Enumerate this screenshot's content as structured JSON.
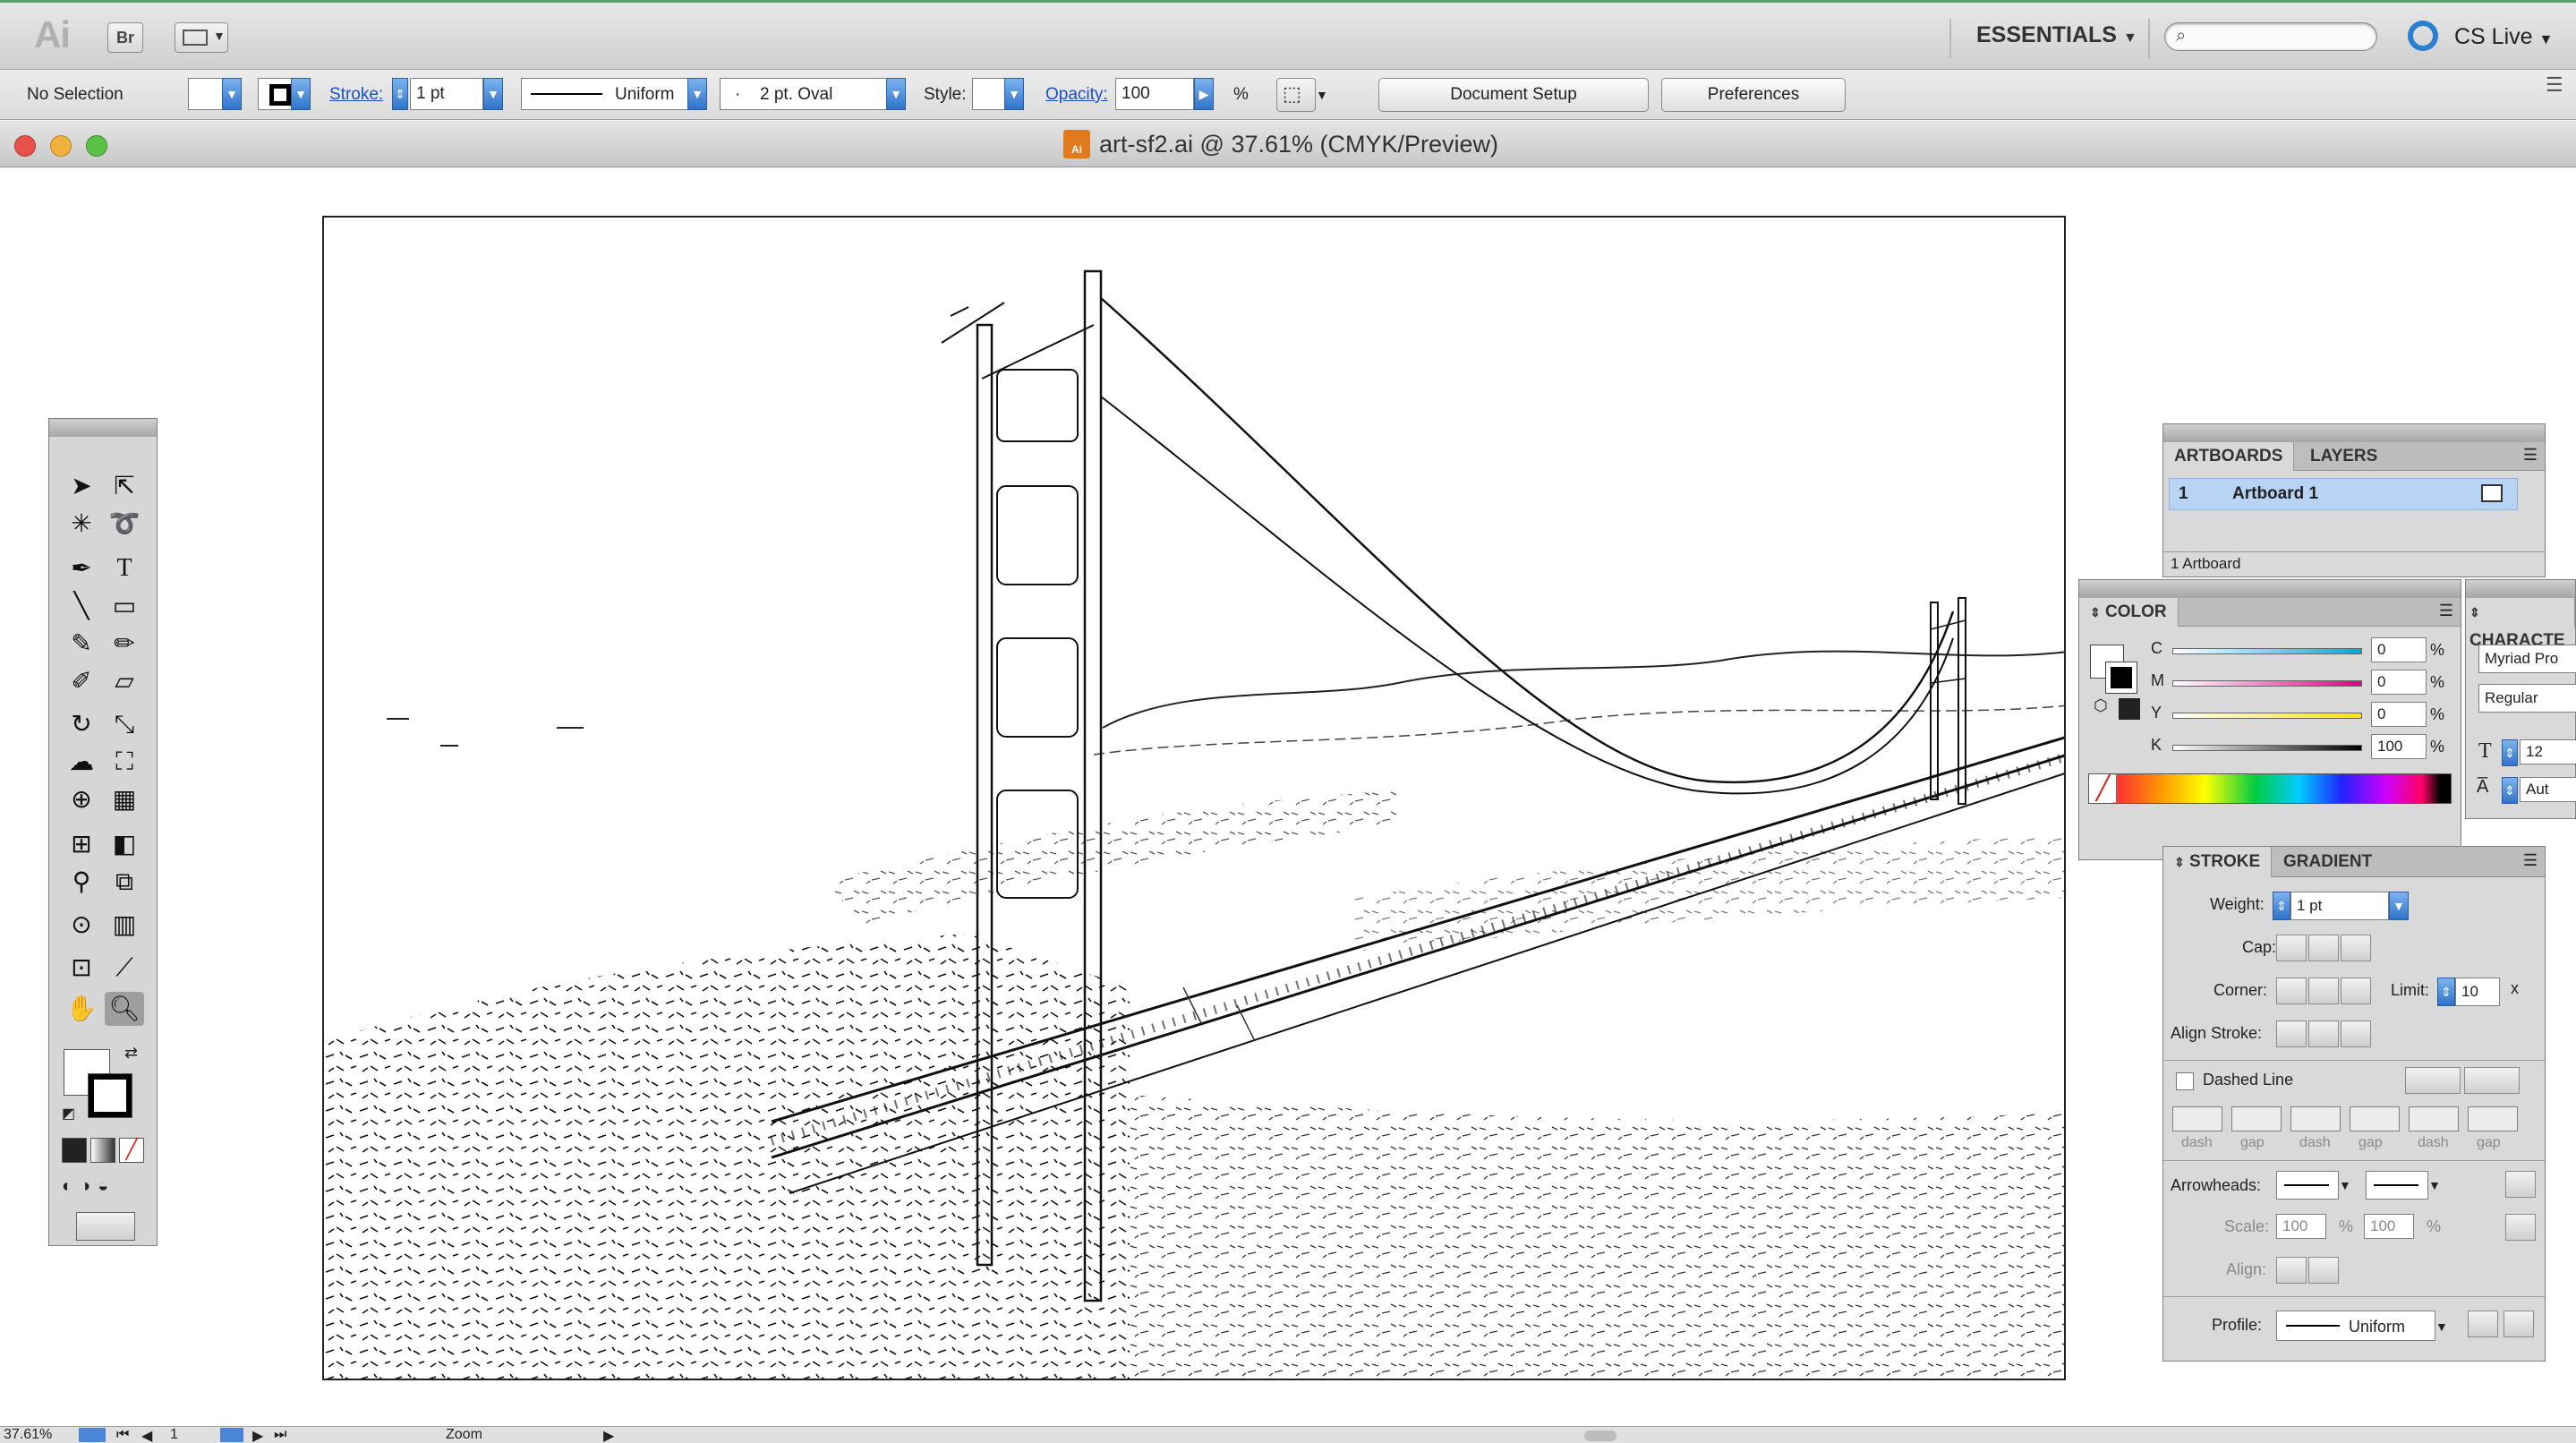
{
  "appbar": {
    "logo": "Ai",
    "bridge_button": "Br",
    "workspace": "ESSENTIALS",
    "search_placeholder": "",
    "cs_live": "CS Live"
  },
  "control": {
    "selection": "No Selection",
    "stroke_label": "Stroke:",
    "stroke_value": "1 pt",
    "line_profile": "Uniform",
    "brush": "2 pt. Oval",
    "style_label": "Style:",
    "opacity_label": "Opacity:",
    "opacity_value": "100",
    "percent": "%",
    "document_setup": "Document Setup",
    "preferences": "Preferences"
  },
  "document": {
    "icon_text": "Ai",
    "title": "art-sf2.ai @ 37.61% (CMYK/Preview)"
  },
  "artboards_panel": {
    "tabs": [
      "ARTBOARDS",
      "LAYERS"
    ],
    "rows": [
      {
        "num": "1",
        "name": "Artboard 1"
      }
    ],
    "footer": "1 Artboard"
  },
  "color_panel": {
    "title": "COLOR",
    "channels": [
      {
        "label": "C",
        "value": "0"
      },
      {
        "label": "M",
        "value": "0"
      },
      {
        "label": "Y",
        "value": "0"
      },
      {
        "label": "K",
        "value": "100"
      }
    ],
    "percent": "%"
  },
  "character_panel": {
    "title": "CHARACTE",
    "font": "Myriad Pro",
    "style": "Regular",
    "size": "12",
    "leading": "Aut"
  },
  "stroke_panel": {
    "tabs": [
      "STROKE",
      "GRADIENT"
    ],
    "weight_label": "Weight:",
    "weight_value": "1 pt",
    "cap_label": "Cap:",
    "corner_label": "Corner:",
    "limit_label": "Limit:",
    "limit_value": "10",
    "limit_unit": "x",
    "align_label": "Align Stroke:",
    "dashed_label": "Dashed Line",
    "dash_labels": [
      "dash",
      "gap",
      "dash",
      "gap",
      "dash",
      "gap"
    ],
    "arrowheads_label": "Arrowheads:",
    "scale_label": "Scale:",
    "scale_start": "100",
    "scale_end": "100",
    "scale_unit": "%",
    "align2_label": "Align:",
    "profile_label": "Profile:",
    "profile_value": "Uniform"
  },
  "status": {
    "zoom": "37.61%",
    "page": "1",
    "tool": "Zoom"
  }
}
